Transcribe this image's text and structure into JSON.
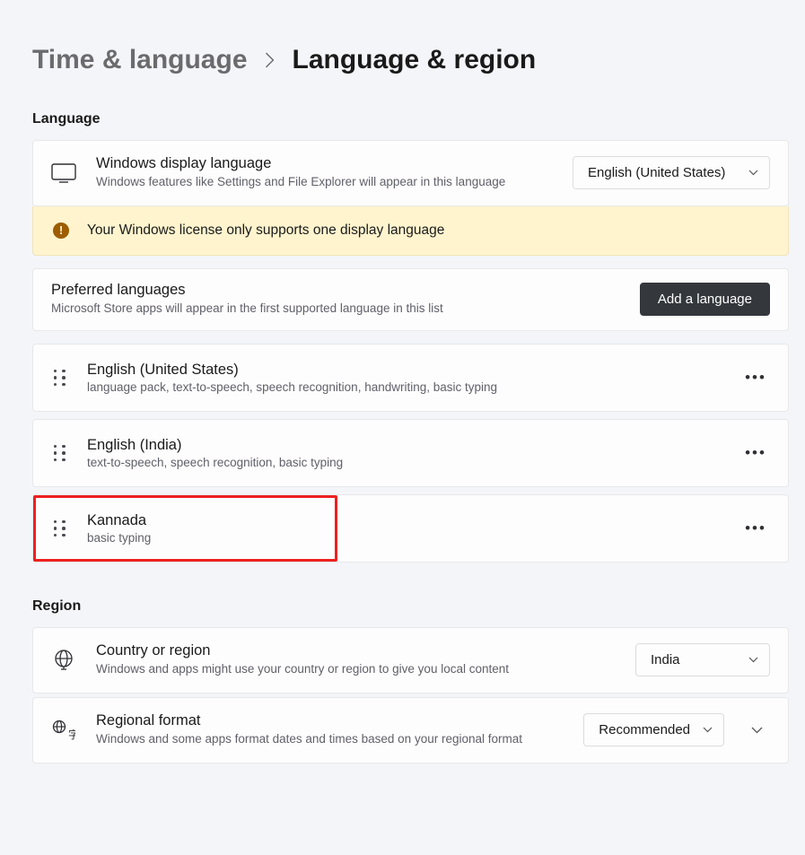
{
  "breadcrumb": {
    "parent": "Time & language",
    "current": "Language & region"
  },
  "language_section": {
    "heading": "Language",
    "display_language": {
      "title": "Windows display language",
      "desc": "Windows features like Settings and File Explorer will appear in this language",
      "value": "English (United States)"
    },
    "warning": "Your Windows license only supports one display language",
    "preferred": {
      "title": "Preferred languages",
      "desc": "Microsoft Store apps will appear in the first supported language in this list",
      "add_button": "Add a language"
    },
    "items": [
      {
        "name": "English (United States)",
        "features": "language pack, text-to-speech, speech recognition, handwriting, basic typing",
        "highlighted": false
      },
      {
        "name": "English (India)",
        "features": "text-to-speech, speech recognition, basic typing",
        "highlighted": false
      },
      {
        "name": "Kannada",
        "features": "basic typing",
        "highlighted": true
      }
    ]
  },
  "region_section": {
    "heading": "Region",
    "country": {
      "title": "Country or region",
      "desc": "Windows and apps might use your country or region to give you local content",
      "value": "India"
    },
    "format": {
      "title": "Regional format",
      "desc": "Windows and some apps format dates and times based on your regional format",
      "value": "Recommended"
    }
  }
}
